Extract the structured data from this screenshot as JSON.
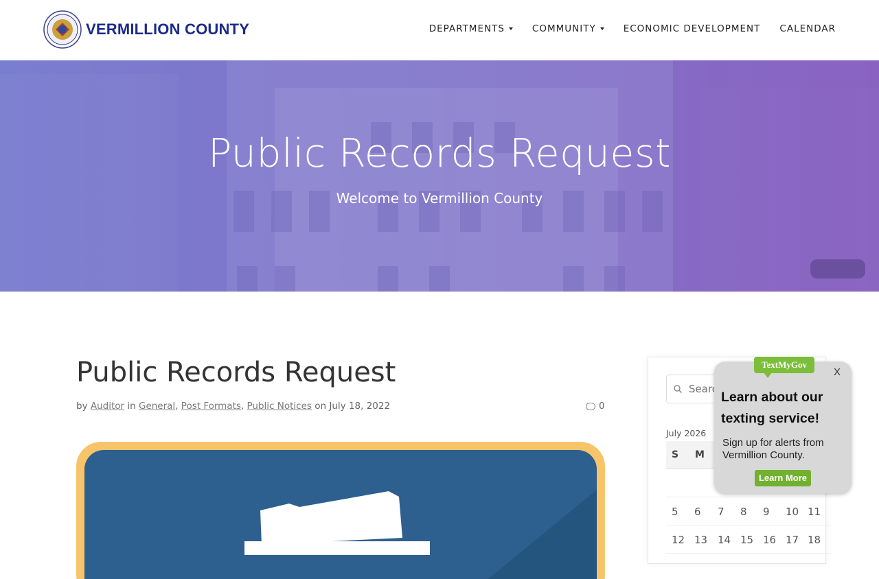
{
  "header": {
    "logo_text": "VERMILLION COUNTY",
    "nav": [
      {
        "label": "DEPARTMENTS",
        "dropdown": true
      },
      {
        "label": "COMMUNITY",
        "dropdown": true
      },
      {
        "label": "ECONOMIC DEVELOPMENT",
        "dropdown": false
      },
      {
        "label": "CALENDAR",
        "dropdown": false
      }
    ]
  },
  "hero": {
    "title": "Public Records Request",
    "subtitle": "Welcome to Vermillion County"
  },
  "post": {
    "title": "Public Records Request",
    "by": "by",
    "author": "Auditor",
    "in": "in",
    "categories": [
      "General",
      "Post Formats",
      "Public Notices"
    ],
    "on": "on",
    "date": "July 18, 2022",
    "comments": "0"
  },
  "sidebar": {
    "search_placeholder": "Search",
    "calendar_caption": "July 2026",
    "weekdays": [
      "S",
      "M"
    ],
    "rows": [
      [
        "5",
        "6",
        "7",
        "8",
        "9",
        "10",
        "11"
      ],
      [
        "12",
        "13",
        "14",
        "15",
        "16",
        "17",
        "18"
      ]
    ]
  },
  "popup": {
    "badge": "TextMyGov",
    "close": "X",
    "title": "Learn about our texting service!",
    "text": "Sign up for alerts from Vermillion County.",
    "button": "Learn More"
  },
  "colors": {
    "brand_blue": "#1b2a8a",
    "hero_overlay": "#7f73c9",
    "popup_green": "#72b02f"
  }
}
